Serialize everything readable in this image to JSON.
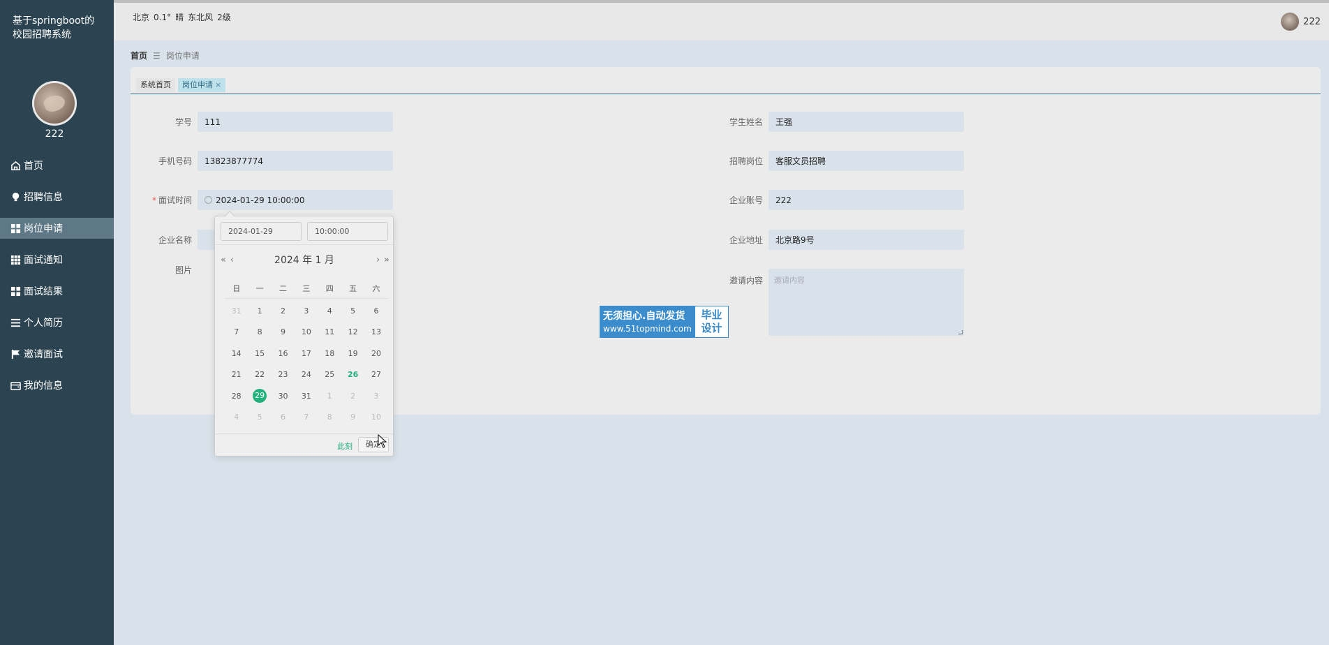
{
  "app": {
    "title": "基于springboot的校园招聘系统",
    "username": "222"
  },
  "sidebar": {
    "items": [
      {
        "label": "首页",
        "icon": "home-icon"
      },
      {
        "label": "招聘信息",
        "icon": "bulb-icon"
      },
      {
        "label": "岗位申请",
        "icon": "grid-icon",
        "active": true
      },
      {
        "label": "面试通知",
        "icon": "table-icon"
      },
      {
        "label": "面试结果",
        "icon": "grid-icon"
      },
      {
        "label": "个人简历",
        "icon": "list-icon"
      },
      {
        "label": "邀请面试",
        "icon": "flag-icon"
      },
      {
        "label": "我的信息",
        "icon": "wallet-icon"
      }
    ]
  },
  "header": {
    "weather": {
      "city": "北京",
      "temp": "0.1°",
      "condition": "晴",
      "wind": "东北风",
      "level": "2级"
    },
    "username": "222"
  },
  "breadcrumb": {
    "home": "首页",
    "separator": "☰",
    "current": "岗位申请"
  },
  "tabs": [
    {
      "label": "系统首页"
    },
    {
      "label": "岗位申请",
      "close": "×"
    }
  ],
  "form": {
    "student_id": {
      "label": "学号",
      "value": "111"
    },
    "student_name": {
      "label": "学生姓名",
      "value": "王强"
    },
    "phone": {
      "label": "手机号码",
      "value": "13823877774"
    },
    "position": {
      "label": "招聘岗位",
      "value": "客服文员招聘"
    },
    "interview_time": {
      "label": "面试时间",
      "required": "*",
      "value": "2024-01-29 10:00:00"
    },
    "company_account": {
      "label": "企业账号",
      "value": "222"
    },
    "company_name": {
      "label": "企业名称"
    },
    "company_address": {
      "label": "企业地址",
      "value": "北京路9号"
    },
    "image": {
      "label": "图片"
    },
    "invite_content": {
      "label": "邀请内容",
      "placeholder": "邀请内容"
    }
  },
  "datepicker": {
    "date_value": "2024-01-29",
    "time_value": "10:00:00",
    "nav_prev_year": "«",
    "nav_prev_month": "‹",
    "nav_next_month": "›",
    "nav_next_year": "»",
    "title": "2024 年  1 月",
    "weekdays": [
      "日",
      "一",
      "二",
      "三",
      "四",
      "五",
      "六"
    ],
    "weeks": [
      [
        "31",
        "1",
        "2",
        "3",
        "4",
        "5",
        "6"
      ],
      [
        "7",
        "8",
        "9",
        "10",
        "11",
        "12",
        "13"
      ],
      [
        "14",
        "15",
        "16",
        "17",
        "18",
        "19",
        "20"
      ],
      [
        "21",
        "22",
        "23",
        "24",
        "25",
        "26",
        "27"
      ],
      [
        "28",
        "29",
        "30",
        "31",
        "1",
        "2",
        "3"
      ],
      [
        "4",
        "5",
        "6",
        "7",
        "8",
        "9",
        "10"
      ]
    ],
    "today": "26",
    "selected": "29",
    "now_label": "此刻",
    "ok_label": "确定"
  },
  "banner": {
    "line1": "无须担心.自动发货",
    "line2": "www.51topmind.com",
    "right1": "毕业",
    "right2": "设计"
  }
}
